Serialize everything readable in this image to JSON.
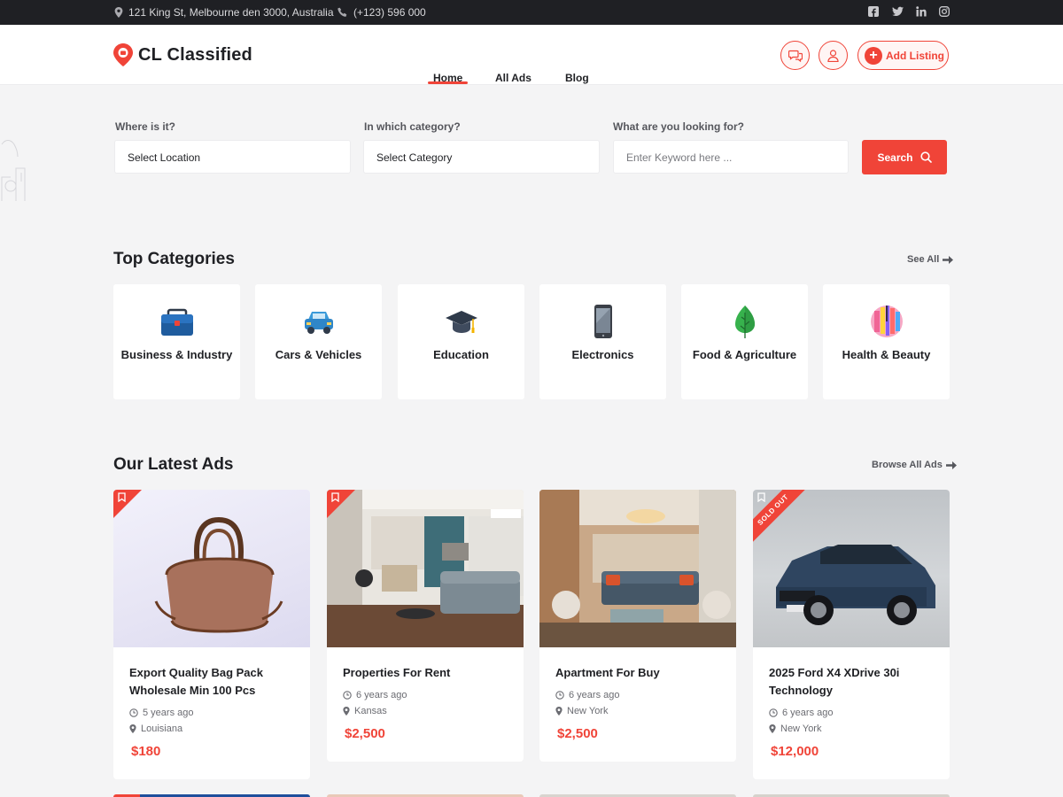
{
  "topbar": {
    "address": "121 King St, Melbourne den 3000, Australia",
    "phone": "(+123) 596 000",
    "social": [
      "facebook-icon",
      "twitter-icon",
      "linkedin-icon",
      "instagram-icon"
    ]
  },
  "header": {
    "brand": "CL Classified",
    "nav": [
      "Home",
      "All Ads",
      "Blog"
    ],
    "active_nav": "Home",
    "add_listing": "Add Listing"
  },
  "search": {
    "location_label": "Where is it?",
    "location_value": "Select Location",
    "category_label": "In which category?",
    "category_value": "Select Category",
    "keyword_label": "What are you looking for?",
    "keyword_placeholder": "Enter Keyword here ...",
    "button": "Search"
  },
  "categories": {
    "title": "Top Categories",
    "see_all": "See All",
    "items": [
      {
        "name": "Business & Industry",
        "icon": "briefcase-icon"
      },
      {
        "name": "Cars & Vehicles",
        "icon": "car-icon"
      },
      {
        "name": "Education",
        "icon": "graduation-cap-icon"
      },
      {
        "name": "Electronics",
        "icon": "smartphone-icon"
      },
      {
        "name": "Food & Agriculture",
        "icon": "leaf-icon"
      },
      {
        "name": "Health & Beauty",
        "icon": "beauty-icon"
      }
    ]
  },
  "ads": {
    "title": "Our Latest Ads",
    "browse_all": "Browse All Ads",
    "items": [
      {
        "title": "Export Quality Bag Pack Wholesale Min 100 Pcs",
        "time": "5 years ago",
        "location": "Louisiana",
        "price": "$180",
        "badge": "bookmark"
      },
      {
        "title": "Properties For Rent",
        "time": "6 years ago",
        "location": "Kansas",
        "price": "$2,500",
        "badge": "bookmark"
      },
      {
        "title": "Apartment For Buy",
        "time": "6 years ago",
        "location": "New York",
        "price": "$2,500",
        "badge": ""
      },
      {
        "title": "2025 Ford X4 XDrive 30i Technology",
        "time": "6 years ago",
        "location": "New York",
        "price": "$12,000",
        "badge": "bookmark",
        "sold_label": "SOLD OUT"
      }
    ]
  },
  "colors": {
    "accent": "#f04438",
    "dark": "#1f2024",
    "page_bg": "#f4f4f5"
  }
}
